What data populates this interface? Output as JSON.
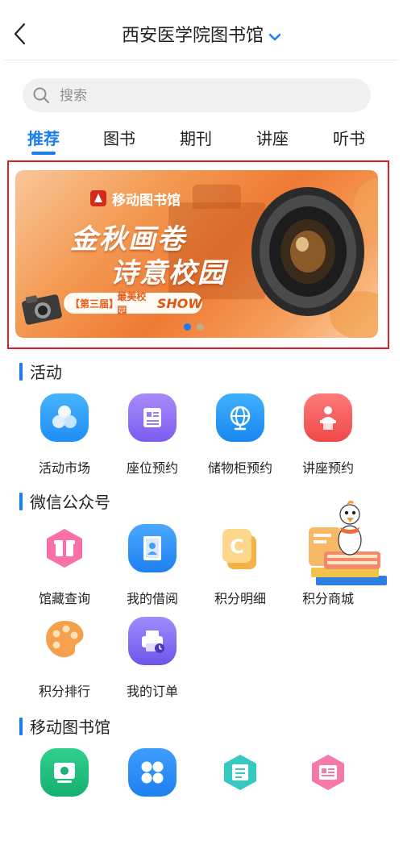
{
  "header": {
    "title": "西安医学院图书馆"
  },
  "search": {
    "placeholder": "搜索"
  },
  "tabs": [
    {
      "label": "推荐"
    },
    {
      "label": "图书"
    },
    {
      "label": "期刊"
    },
    {
      "label": "讲座"
    },
    {
      "label": "听书"
    }
  ],
  "active_tab": 0,
  "banner": {
    "brand": "移动图书馆",
    "headline_line1": "金秋画卷",
    "headline_line2": "诗意校园",
    "ribbon_edition": "【第三届】",
    "ribbon_text": "最美校园",
    "ribbon_show": "SHOW",
    "page_count": 2,
    "current_page": 0
  },
  "sections": {
    "activities": {
      "title": "活动",
      "items": [
        {
          "label": "活动市场",
          "icon": "circles-icon"
        },
        {
          "label": "座位预约",
          "icon": "document-icon"
        },
        {
          "label": "储物柜预约",
          "icon": "globe-icon"
        },
        {
          "label": "讲座预约",
          "icon": "podium-icon"
        }
      ]
    },
    "wechat": {
      "title": "微信公众号",
      "items": [
        {
          "label": "馆藏查询",
          "icon": "gift-hexagon-icon"
        },
        {
          "label": "我的借阅",
          "icon": "book-portrait-icon"
        },
        {
          "label": "积分明细",
          "icon": "coin-c-icon"
        },
        {
          "label": "积分商城",
          "icon": "shop-icon"
        },
        {
          "label": "积分排行",
          "icon": "palette-icon"
        },
        {
          "label": "我的订单",
          "icon": "order-printer-icon"
        }
      ]
    },
    "mobile_library": {
      "title": "移动图书馆",
      "items": [
        {
          "icon": "monitor-icon"
        },
        {
          "icon": "grid-apps-icon"
        },
        {
          "icon": "scroll-hexagon-icon"
        },
        {
          "icon": "card-hexagon-icon"
        }
      ]
    }
  },
  "colors": {
    "accent": "#1a7ef0",
    "highlight_border": "#e02020"
  }
}
